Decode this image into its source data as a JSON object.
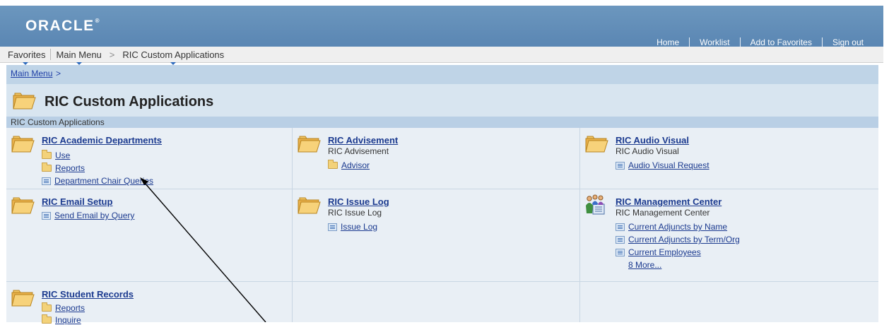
{
  "header": {
    "logo": "ORACLE",
    "logo_mark": "®",
    "nav": [
      "Home",
      "Worklist",
      "Add to Favorites",
      "Sign out"
    ]
  },
  "menubar": {
    "favorites": "Favorites",
    "main_menu": "Main Menu",
    "separator": ">",
    "current": "RIC Custom Applications"
  },
  "breadcrumb": {
    "link": "Main Menu",
    "separator": ">"
  },
  "page": {
    "title": "RIC Custom Applications",
    "section_label": "RIC Custom Applications"
  },
  "tiles": [
    {
      "title": "RIC Academic Departments",
      "subtitle": "",
      "links": [
        {
          "label": "Use",
          "icon": "folder-icon"
        },
        {
          "label": "Reports",
          "icon": "folder-icon"
        },
        {
          "label": "Department Chair Queries",
          "icon": "component-icon"
        }
      ]
    },
    {
      "title": "RIC Advisement",
      "subtitle": "RIC Advisement",
      "links": [
        {
          "label": "Advisor",
          "icon": "folder-icon"
        }
      ]
    },
    {
      "title": "RIC Audio Visual",
      "subtitle": "RIC Audio Visual",
      "links": [
        {
          "label": "Audio Visual Request",
          "icon": "component-icon"
        }
      ]
    },
    {
      "title": "RIC Email Setup",
      "subtitle": "",
      "links": [
        {
          "label": "Send Email by Query",
          "icon": "component-icon"
        }
      ]
    },
    {
      "title": "RIC Issue Log",
      "subtitle": "RIC Issue Log",
      "links": [
        {
          "label": "Issue Log",
          "icon": "component-icon"
        }
      ]
    },
    {
      "title": "RIC Management Center",
      "subtitle": "RIC Management Center",
      "links": [
        {
          "label": "Current Adjuncts by Name",
          "icon": "component-icon"
        },
        {
          "label": "Current Adjuncts by Term/Org",
          "icon": "component-icon"
        },
        {
          "label": "Current Employees",
          "icon": "component-icon"
        }
      ],
      "more": "8 More..."
    },
    {
      "title": "RIC Student Records",
      "subtitle": "",
      "links": [
        {
          "label": "Reports",
          "icon": "folder-icon"
        },
        {
          "label": "Inquire",
          "icon": "folder-icon"
        }
      ]
    }
  ],
  "colors": {
    "banner": "#5a86b3",
    "link": "#1b3a8f",
    "crumb_bar": "#bfd4e7",
    "title_bar": "#d8e5f0",
    "grid_bg": "#e9eff5"
  }
}
